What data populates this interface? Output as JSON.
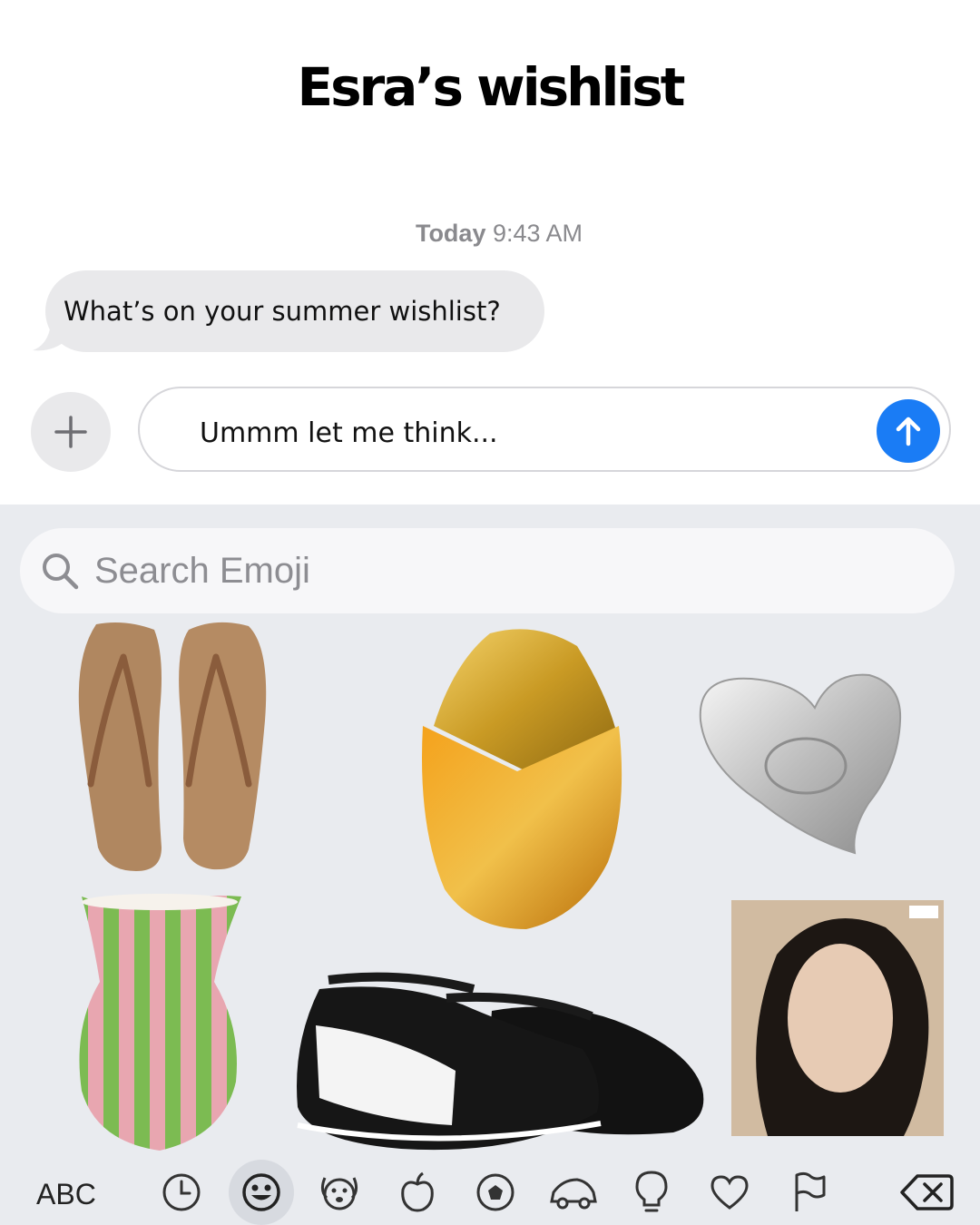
{
  "header": {
    "title": "Esra’s wishlist"
  },
  "conversation": {
    "timestamp_day": "Today",
    "timestamp_time": "9:43 AM",
    "incoming_message": "What’s on your summer wishlist?"
  },
  "composer": {
    "text": "Ummm let me think..."
  },
  "emoji_keyboard": {
    "search_placeholder": "Search Emoji",
    "abc_label": "ABC",
    "categories": [
      "clock-icon",
      "smiley-icon",
      "dog-face-icon",
      "apple-icon",
      "soccer-ball-icon",
      "car-icon",
      "lightbulb-icon",
      "heart-icon",
      "flag-icon"
    ],
    "active_category": "smiley-icon"
  },
  "wishlist_items": [
    "flip-flops",
    "amber perfume bottle",
    "heart perfume bottle",
    "striped vase",
    "black ballet sneakers",
    "album cover"
  ],
  "colors": {
    "send_button": "#1a7cf5",
    "bubble_gray": "#e9e9eb",
    "keyboard_bg": "#e9ebef"
  }
}
